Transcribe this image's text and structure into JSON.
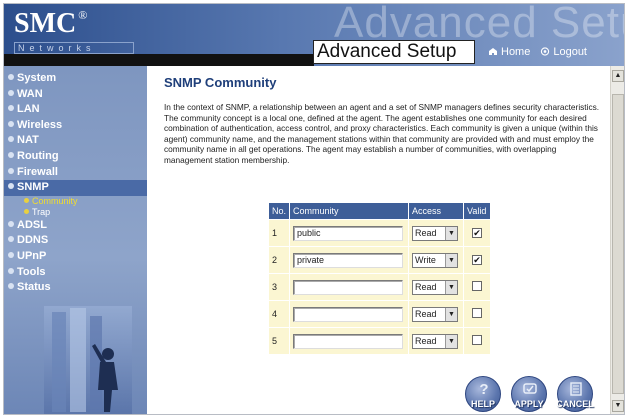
{
  "header": {
    "logo": "SMC",
    "logo_mark": "®",
    "networks": "Networks",
    "watermark": "Advanced Setup",
    "title": "Advanced Setup",
    "home": "Home",
    "logout": "Logout"
  },
  "sidebar": {
    "items": [
      {
        "label": "System"
      },
      {
        "label": "WAN"
      },
      {
        "label": "LAN"
      },
      {
        "label": "Wireless"
      },
      {
        "label": "NAT"
      },
      {
        "label": "Routing"
      },
      {
        "label": "Firewall"
      },
      {
        "label": "SNMP",
        "active": true
      },
      {
        "label": "Community",
        "sub": true,
        "current": true
      },
      {
        "label": "Trap",
        "sub": true
      },
      {
        "label": "ADSL"
      },
      {
        "label": "DDNS"
      },
      {
        "label": "UPnP"
      },
      {
        "label": "Tools"
      },
      {
        "label": "Status"
      }
    ]
  },
  "main": {
    "title": "SNMP Community",
    "description": "In the context of SNMP, a relationship between an agent and a set of SNMP managers defines security characteristics. The community concept is a local one, defined at the agent. The agent establishes one community for each desired combination of authentication, access control, and proxy characteristics. Each community is given a unique (within this agent) community name, and the management stations within that community are provided with and must employ the community name in all get operations. The agent may establish a number of communities, with overlapping management station membership."
  },
  "table": {
    "headers": {
      "no": "No.",
      "community": "Community",
      "access": "Access",
      "valid": "Valid"
    },
    "rows": [
      {
        "no": "1",
        "community": "public",
        "access": "Read",
        "valid": true
      },
      {
        "no": "2",
        "community": "private",
        "access": "Write",
        "valid": true
      },
      {
        "no": "3",
        "community": "",
        "access": "Read",
        "valid": false
      },
      {
        "no": "4",
        "community": "",
        "access": "Read",
        "valid": false
      },
      {
        "no": "5",
        "community": "",
        "access": "Read",
        "valid": false
      }
    ]
  },
  "buttons": {
    "help": "HELP",
    "apply": "APPLY",
    "cancel": "CANCEL"
  },
  "colors": {
    "header_blue": "#2c4e8c",
    "sidebar_blue": "#8ea4ca",
    "table_header": "#3e5e98",
    "table_cell": "#fbf6d2",
    "title_blue": "#1f3f7a"
  },
  "icons": {
    "home": "home-icon",
    "logout": "logout-icon",
    "help": "question-icon",
    "apply": "apply-icon",
    "cancel": "cancel-icon"
  }
}
